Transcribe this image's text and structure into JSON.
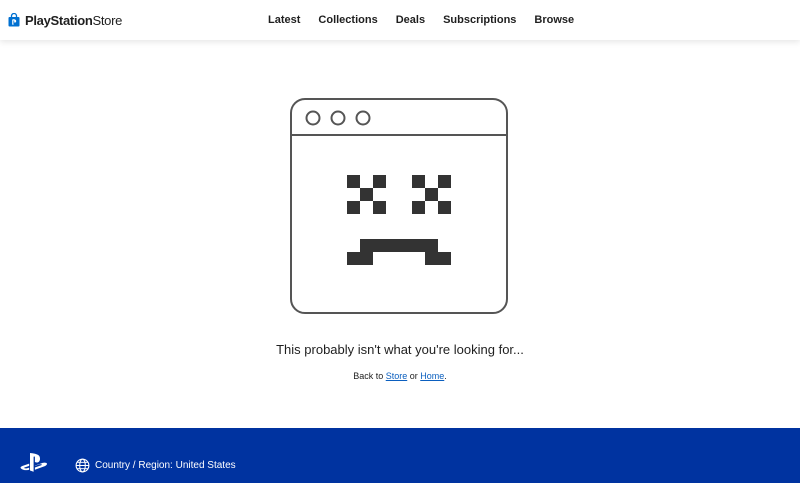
{
  "header": {
    "brand_bold": "PlayStation",
    "brand_rest": "Store",
    "nav": [
      {
        "label": "Latest"
      },
      {
        "label": "Collections"
      },
      {
        "label": "Deals"
      },
      {
        "label": "Subscriptions"
      },
      {
        "label": "Browse"
      }
    ]
  },
  "error": {
    "message": "This probably isn't what you're looking for...",
    "back_prefix": "Back to ",
    "store_link": "Store",
    "or_text": " or ",
    "home_link": "Home",
    "suffix": "."
  },
  "footer": {
    "region_text": "Country / Region: United States"
  },
  "icons": {
    "brand": "playstation-store-bag-icon",
    "illustration": "sad-browser-window-icon",
    "footer_logo": "playstation-logo-icon",
    "region": "globe-icon"
  },
  "colors": {
    "footer_background": "#0033a0",
    "link": "#0b5fbf",
    "illustration_stroke": "#555555",
    "pixel_face": "#333333"
  }
}
